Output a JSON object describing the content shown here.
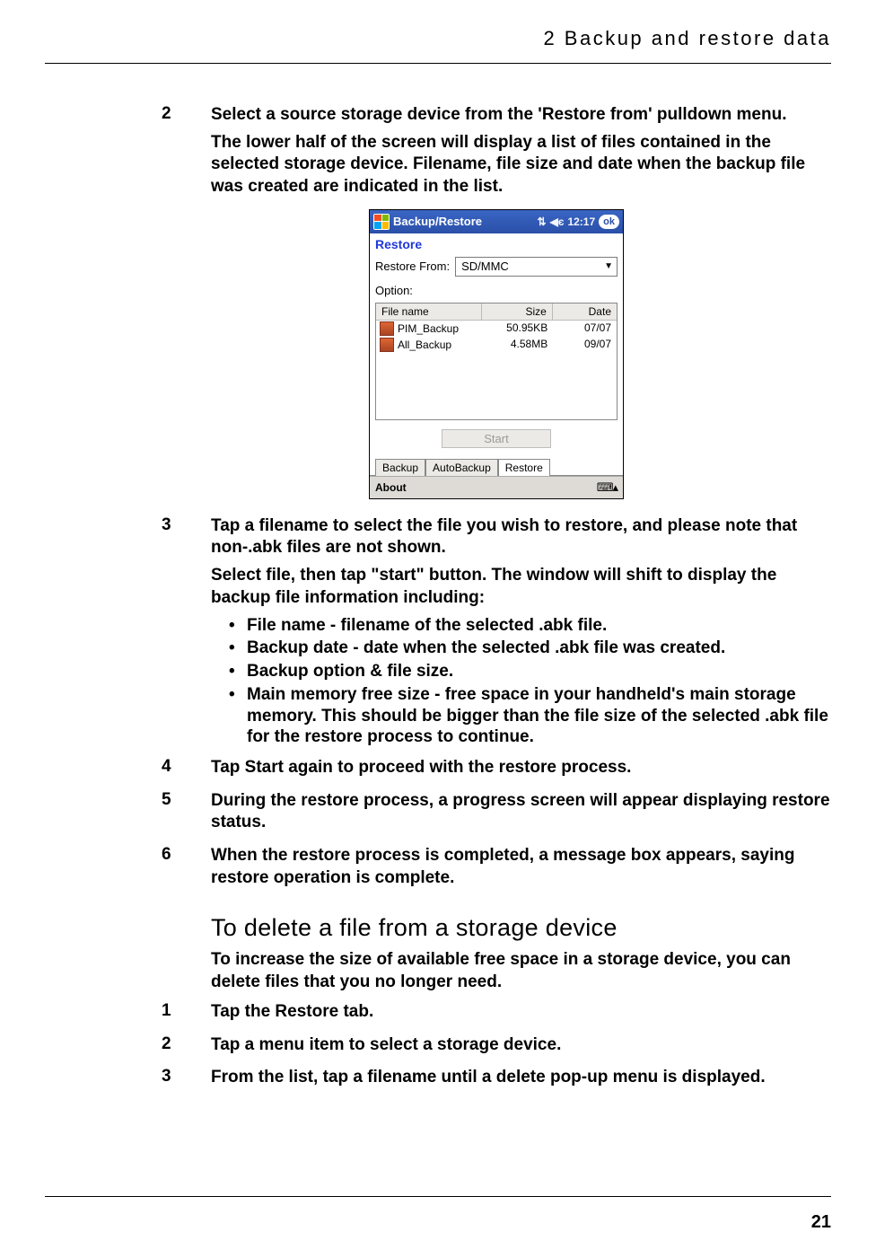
{
  "header": {
    "running_title": "2 Backup and restore data"
  },
  "footer": {
    "page_number": "21"
  },
  "steps": {
    "s2_num": "2",
    "s2_p1": "Select a source storage device from the 'Restore from' pulldown menu.",
    "s2_p2": "The lower half of the screen will display a list of files contained in the selected storage device. Filename, file size and date when the backup file was created are indicated in the list.",
    "s3_num": "3",
    "s3_p1": "Tap a filename to select the file you wish to restore, and please note that non-.abk files are not shown.",
    "s3_p2": "Select file, then tap \"start\" button. The window will shift to display the backup file information including:",
    "s3_b1": "File name - filename of the selected .abk file.",
    "s3_b2": "Backup date - date when the selected .abk file was created.",
    "s3_b3": "Backup option & file size.",
    "s3_b4": "Main memory free size - free space in your handheld's main storage memory. This should be bigger than the file size of the selected .abk file for the restore process to continue.",
    "s4_num": "4",
    "s4_p1": "Tap Start again to proceed with the restore process.",
    "s5_num": "5",
    "s5_p1": "During the restore process, a progress screen will appear displaying restore status.",
    "s6_num": "6",
    "s6_p1": "When the restore process is completed, a message box appears, saying restore operation is complete."
  },
  "section2": {
    "heading": "To delete a file from a storage device",
    "desc": "To increase the size of available free space in a storage device, you can delete files that you no longer need.",
    "d1_num": "1",
    "d1_p1": "Tap the Restore tab.",
    "d2_num": "2",
    "d2_p1": "Tap a menu item to select a storage device.",
    "d3_num": "3",
    "d3_p1": "From the list, tap a filename until a delete pop-up menu is displayed."
  },
  "device": {
    "title": "Backup/Restore",
    "clock": "12:17",
    "ok": "ok",
    "restore_label": "Restore",
    "restore_from_label": "Restore From:",
    "restore_from_value": "SD/MMC",
    "option_label": "Option:",
    "cols": {
      "name": "File name",
      "size": "Size",
      "date": "Date"
    },
    "rows": [
      {
        "name": "PIM_Backup",
        "size": "50.95KB",
        "date": "07/07"
      },
      {
        "name": "All_Backup",
        "size": "4.58MB",
        "date": "09/07"
      }
    ],
    "start": "Start",
    "tabs": {
      "backup": "Backup",
      "auto": "AutoBackup",
      "restore": "Restore"
    },
    "about": "About"
  }
}
